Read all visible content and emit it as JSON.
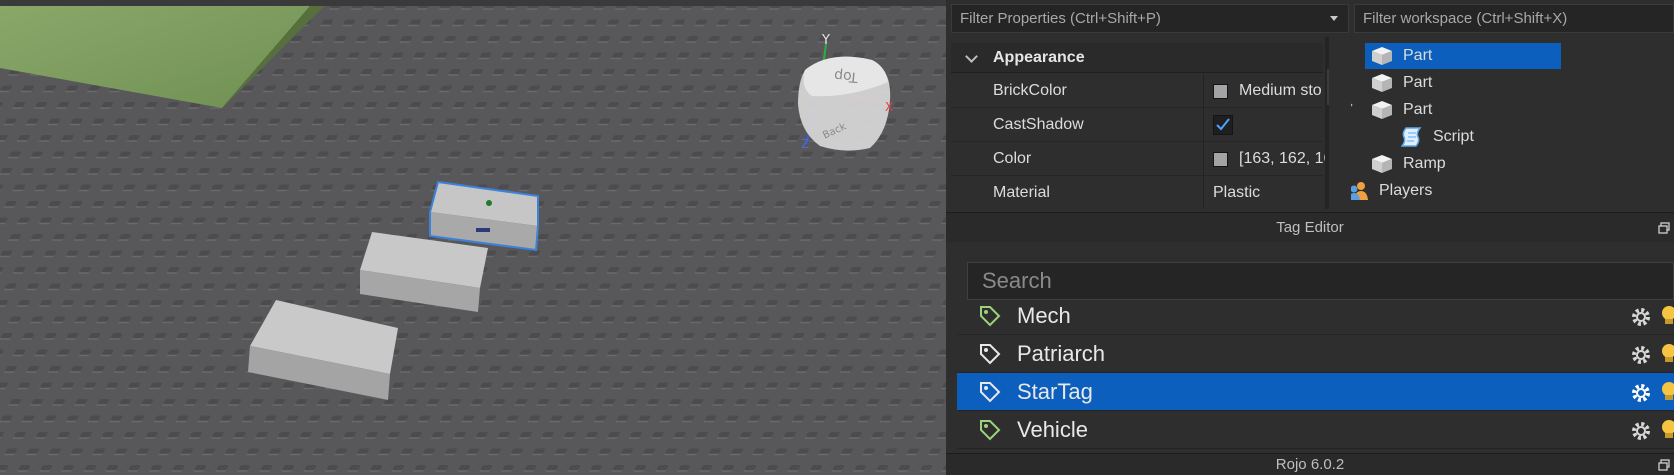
{
  "properties": {
    "filter_placeholder": "Filter Properties (Ctrl+Shift+P)",
    "section": "Appearance",
    "rows": [
      {
        "name": "BrickColor",
        "value": "Medium sto",
        "swatch_color": "#a3a2a5"
      },
      {
        "name": "CastShadow",
        "checked": true
      },
      {
        "name": "Color",
        "value": "[163, 162, 16",
        "swatch_color": "#a3a2a5"
      },
      {
        "name": "Material",
        "value": "Plastic"
      }
    ]
  },
  "explorer": {
    "filter_placeholder": "Filter workspace (Ctrl+Shift+X)",
    "items": [
      {
        "label": "Part",
        "selected": true
      },
      {
        "label": "Part"
      },
      {
        "label": "Part",
        "expanded": true
      },
      {
        "label": "Script"
      },
      {
        "label": "Ramp"
      },
      {
        "label": "Players"
      }
    ]
  },
  "tag_editor": {
    "title": "Tag Editor",
    "search_placeholder": "Search",
    "tags": [
      {
        "name": "Mech"
      },
      {
        "name": "Patriarch"
      },
      {
        "name": "StarTag",
        "selected": true
      },
      {
        "name": "Vehicle"
      }
    ]
  },
  "bottom_panel": {
    "title": "Rojo 6.0.2"
  },
  "viewcube": {
    "top_label": "Top",
    "back_label": "Back",
    "axis_y": "Y",
    "axis_x": "X",
    "axis_z": "Z"
  },
  "colors": {
    "selection": "#0c5fbd",
    "panel_bg": "#2e2e2e",
    "baseplate": "#58585b",
    "grass": "#7a9a5a"
  }
}
